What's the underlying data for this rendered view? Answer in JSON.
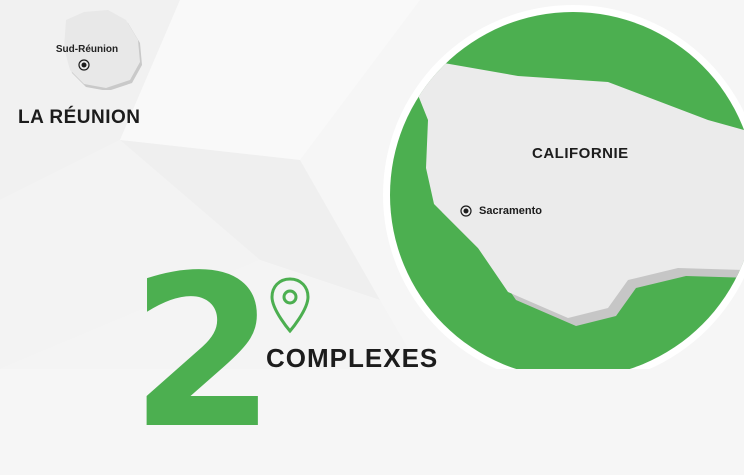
{
  "reunion": {
    "region_label": "Sud-Réunion",
    "title": "LA RÉUNION"
  },
  "stats": {
    "count": "2",
    "label": "COMPLEXES"
  },
  "california": {
    "state_label": "CALIFORNIE",
    "city_label": "Sacramento"
  },
  "icons": {
    "pin": "map-pin-icon",
    "location_dot": "location-dot-icon"
  },
  "colors": {
    "accent": "#4caf50",
    "map_land": "#ebebeb",
    "text": "#1c1c1c"
  }
}
